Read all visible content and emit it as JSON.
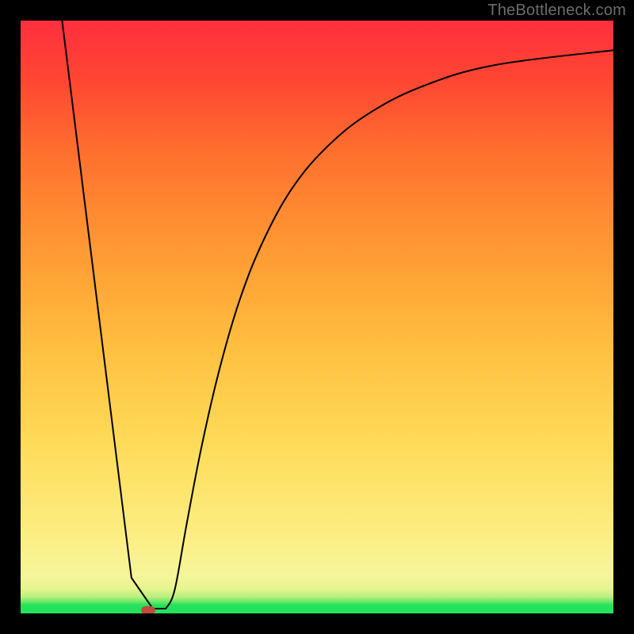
{
  "attribution": "TheBottleneck.com",
  "chart_data": {
    "type": "line",
    "title": "",
    "xlabel": "",
    "ylabel": "",
    "xlim": [
      0,
      100
    ],
    "ylim": [
      0,
      100
    ],
    "background_gradient_stops": [
      {
        "pos": 0.0,
        "color": "#23e35d"
      },
      {
        "pos": 0.014,
        "color": "#23e35d"
      },
      {
        "pos": 0.02,
        "color": "#6fe86a"
      },
      {
        "pos": 0.028,
        "color": "#b8f07e"
      },
      {
        "pos": 0.042,
        "color": "#e7f58f"
      },
      {
        "pos": 0.065,
        "color": "#f6f59a"
      },
      {
        "pos": 0.13,
        "color": "#fcee83"
      },
      {
        "pos": 0.28,
        "color": "#fedc5a"
      },
      {
        "pos": 0.45,
        "color": "#ffbf3f"
      },
      {
        "pos": 0.62,
        "color": "#ff9833"
      },
      {
        "pos": 0.78,
        "color": "#ff6f2f"
      },
      {
        "pos": 0.9,
        "color": "#ff4632"
      },
      {
        "pos": 1.0,
        "color": "#ff2f3e"
      }
    ],
    "series": [
      {
        "name": "bottleneck-curve",
        "x": [
          7.0,
          18.7,
          22.3,
          24.5,
          26.0,
          28.0,
          30.5,
          33.5,
          37.0,
          41.0,
          46.0,
          52.0,
          59.0,
          68.0,
          80.0,
          100.0
        ],
        "y": [
          100.0,
          6.0,
          0.8,
          0.8,
          4.0,
          15.0,
          28.0,
          41.0,
          53.0,
          63.0,
          72.0,
          79.0,
          84.5,
          89.0,
          92.5,
          95.0
        ]
      }
    ],
    "minimum_marker": {
      "x": 21.5,
      "y": 0.6,
      "color": "#c24a3f"
    }
  }
}
